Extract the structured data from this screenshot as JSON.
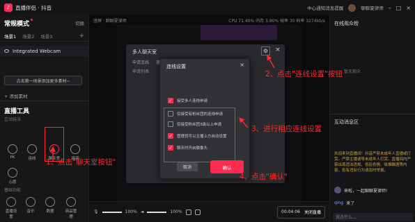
{
  "titlebar": {
    "app_title": "直播伴侣 · 抖音",
    "status_text": "中心通知消息提醒",
    "username": "聊聊夏律师"
  },
  "left": {
    "mode_title": "常规模式",
    "mode_switch": "切换",
    "scene_tabs": [
      "场景1",
      "场景2",
      "场景3"
    ],
    "source": "Integrated Webcam",
    "add_material": "点击第一场景添加更多素材~",
    "add_scene": "+ 添加素材",
    "tools_title": "直播工具",
    "tools_sub": "互动玩法",
    "tools": [
      "PK",
      "连线",
      "聊天室",
      "福袋",
      "心愿"
    ],
    "section2": "基础功能",
    "tools2": [
      "直播设置",
      "音乐",
      "数据",
      "商品管理"
    ]
  },
  "center": {
    "top_label": "竖屏 · 聊聊夏律师",
    "stats": "CPU 71.40%  内存 3.90%  帧率 30  码率 3274kb/s",
    "dialog1": {
      "title": "多人聊天室",
      "tabs": [
        "申请连线",
        "邀请连线"
      ],
      "row": "申请列表"
    },
    "dialog2": {
      "title": "连线设置",
      "options": [
        {
          "label": "接受多人连线申请",
          "checked": true
        },
        {
          "label": "仅接受有粉丝团的连线申请",
          "checked": false
        },
        {
          "label": "仅接受粉丝团3级以上申请",
          "checked": false
        },
        {
          "label": "管理员可以主播上方自动设置",
          "checked": true
        },
        {
          "label": "聊天时开启摄像头",
          "checked": true
        }
      ],
      "cancel": "取消",
      "confirm": "确认"
    },
    "bottombar": {
      "mic_level": "100%",
      "speaker_level": "100%",
      "timer": "00:04:06",
      "stop": "关闭直播"
    }
  },
  "right": {
    "online_title": "在线观众榜",
    "online_empty": "暂无观众",
    "chat_title": "互动消息区",
    "chat_notice": "欢迎来到直播间！抖音严禁未成年人直播或打赏。严禁主播诱导未成年人打赏。直播间内严禁出现违法违规、低俗色情、吸烟酗酒等内容，若有违反行为请及时举报。",
    "msg1": "来啦，一起聊聊夏律师!",
    "msg2_user": "qing",
    "msg2_text": "来了",
    "input_placeholder": "说点什么…"
  },
  "annotations": {
    "step1": "1、点击\"聊天室按钮\"",
    "step2": "2、点击\"连线设置\"按钮",
    "step3": "3、进行相应连线设置",
    "step4": "4、点击\"确认\""
  },
  "colors": {
    "accent": "#fe2c55",
    "annotation": "#ff2a2a"
  }
}
